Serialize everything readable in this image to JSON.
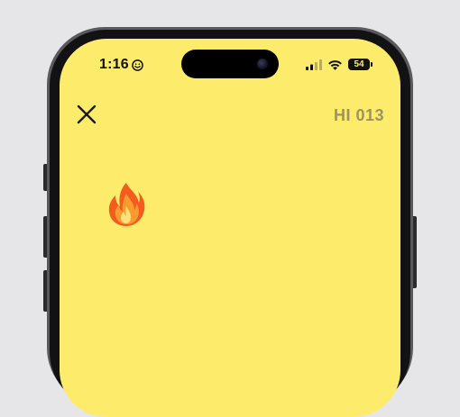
{
  "status_bar": {
    "time": "1:16",
    "focus_icon": "smiley-focus-icon",
    "battery": "54",
    "signal_icon": "cellular-signal-icon",
    "wifi_icon": "wifi-icon"
  },
  "game": {
    "close_icon": "close-icon",
    "hi_score": "HI 013",
    "player_icon": "fire-emoji-icon"
  },
  "colors": {
    "screen_background": "#fdec6b",
    "score_text": "#9b9361"
  }
}
